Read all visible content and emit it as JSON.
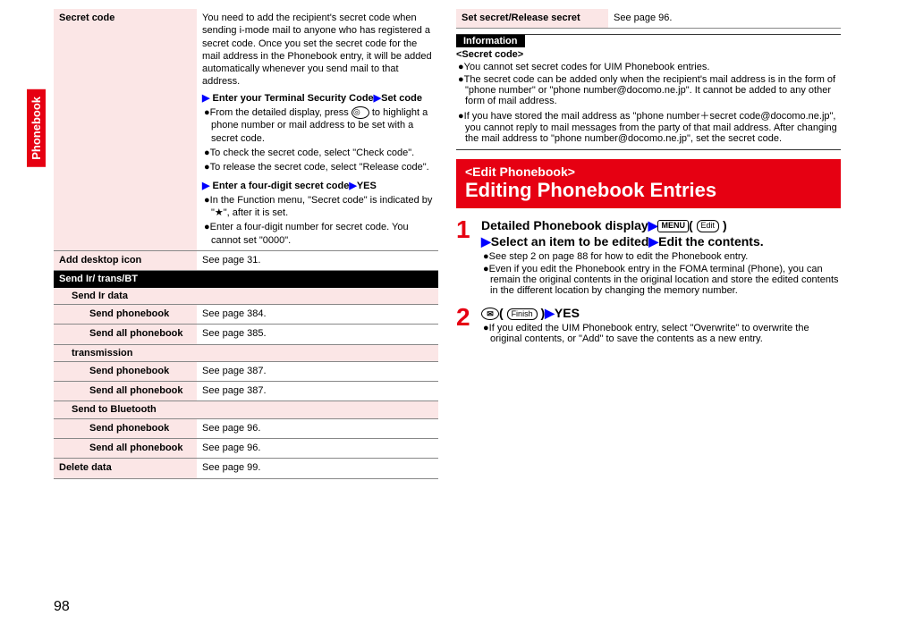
{
  "side_tab": "Phonebook",
  "left": {
    "secret_code": {
      "label": "Secret code",
      "desc": "You need to add the recipient's secret code when sending i-mode mail to anyone who has registered a secret code. Once you set the secret code for the mail address in the Phonebook entry, it will be added automatically whenever you send mail to that address.",
      "step1a": "Enter your Terminal Security Code",
      "step1b": "Set code",
      "b1": "From the detailed display, press",
      "b1tail": "to highlight a phone number or mail address to be set with a secret code.",
      "b2": "To check the secret code, select \"Check code\".",
      "b3": "To release the secret code, select \"Release code\".",
      "step2a": "Enter a four-digit secret code",
      "step2b": "YES",
      "b4": "In the Function menu, \"Secret code\" is indicated by \"★\", after it is set.",
      "b5": "Enter a four-digit number for secret code. You cannot set \"0000\"."
    },
    "add_desktop": {
      "label": "Add desktop icon",
      "val": "See page 31."
    },
    "sendir_header": "Send Ir/    trans/BT",
    "send_ir": {
      "label": "Send Ir data",
      "phonebook_l": "Send phonebook",
      "phonebook_v": "See page 384.",
      "all_l": "Send all phonebook",
      "all_v": "See page 385."
    },
    "ic": {
      "label": "    transmission",
      "phonebook_l": "Send phonebook",
      "phonebook_v": "See page 387.",
      "all_l": "Send all phonebook",
      "all_v": "See page 387."
    },
    "bt": {
      "label": "Send to Bluetooth",
      "phonebook_l": "Send phonebook",
      "phonebook_v": "See page 96.",
      "all_l": "Send all phonebook",
      "all_v": "See page 96."
    },
    "delete": {
      "label": "Delete data",
      "val": "See page 99."
    }
  },
  "right": {
    "setsecret": {
      "label": "Set secret/Release secret",
      "val": "See page 96."
    },
    "info": {
      "title": "Information",
      "head": "<Secret code>",
      "b1": "You cannot set secret codes for UIM Phonebook entries.",
      "b2": "The secret code can be added only when the recipient's mail address is in the form of \"phone number\" or \"phone number@docomo.ne.jp\". It cannot be added to any other form of mail address.",
      "b3": "If you have stored the mail address as \"phone number＋secret code@docomo.ne.jp\", you cannot reply to mail messages from the party of that mail address. After changing the mail address to \"phone number@docomo.ne.jp\", set the secret code."
    },
    "banner": {
      "small": "<Edit Phonebook>",
      "big": "Editing Phonebook Entries"
    },
    "step1": {
      "line1a": "Detailed Phonebook display",
      "menu": "MENU",
      "edit": "Edit",
      "line2a": "Select an item to be edited",
      "line2b": "Edit the contents.",
      "b1": "See step 2 on page 88 for how to edit the Phonebook entry.",
      "b2": "Even if you edit the Phonebook entry in the FOMA terminal (Phone), you can remain the original contents in the original location and store the edited contents in the different location by changing the memory number."
    },
    "step2": {
      "mail": "✉",
      "finish": "Finish",
      "yes": "YES",
      "b1": "If you edited the UIM Phonebook entry, select \"Overwrite\" to overwrite the original contents, or \"Add\" to save the contents as a new entry."
    }
  },
  "page_num": "98"
}
